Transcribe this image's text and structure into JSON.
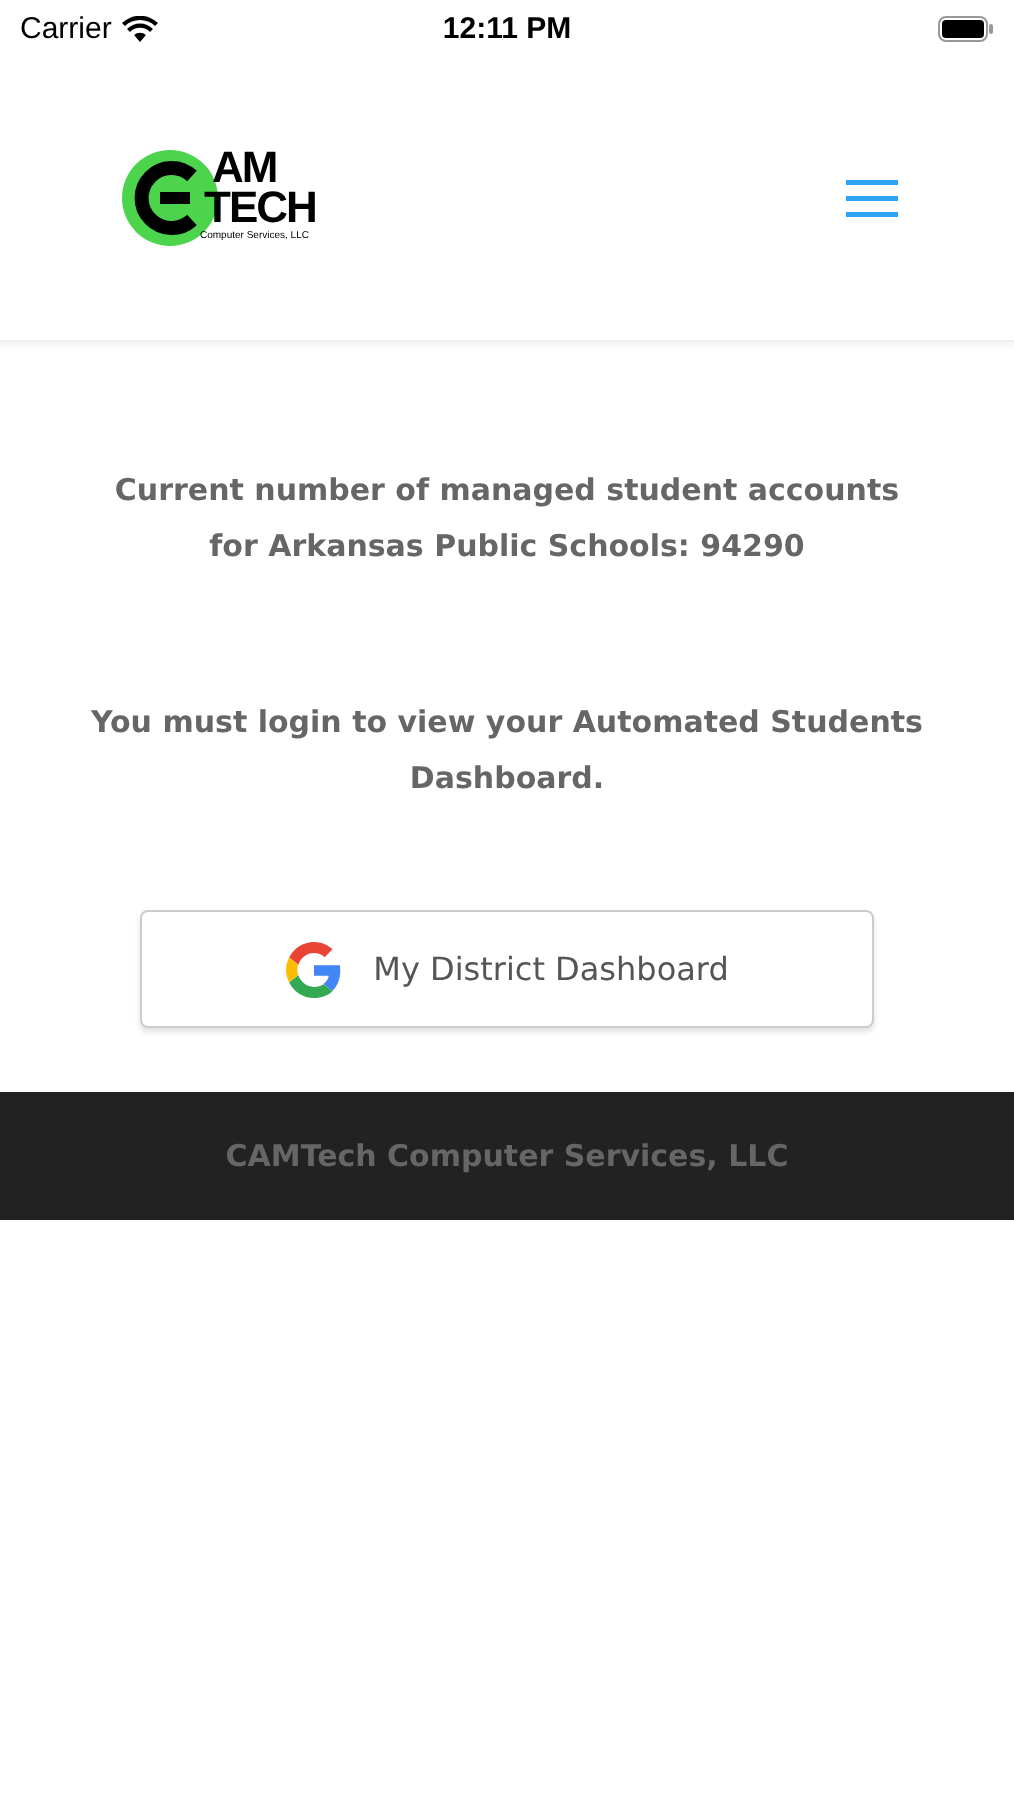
{
  "status_bar": {
    "carrier": "Carrier",
    "time": "12:11 PM"
  },
  "header": {
    "logo": {
      "line_1": "AM",
      "line_2": "TECH",
      "tagline": "Computer Services, LLC"
    }
  },
  "content": {
    "count_text": "Current number of managed student accounts for Arkansas Public Schools: 94290",
    "login_text": "You must login to view your Automated Students Dashboard.",
    "button": "My District Dashboard"
  },
  "footer": {
    "text": "CAMTech Computer Services, LLC"
  }
}
